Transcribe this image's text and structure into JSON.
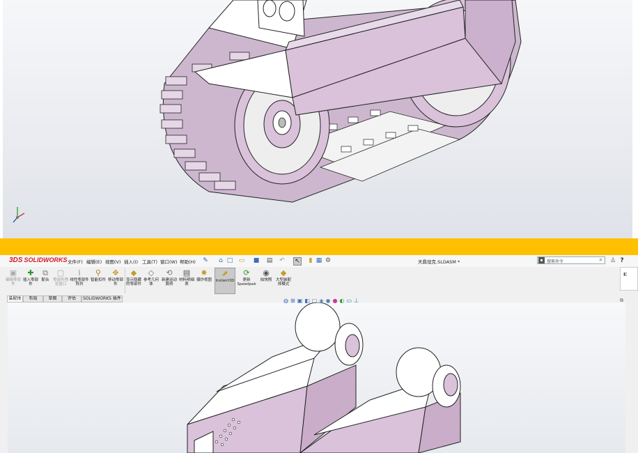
{
  "colors": {
    "divider": "#fec000",
    "part_fill": "#d9c2da",
    "part_face_light": "#ffffff",
    "brand_red": "#d31a24",
    "accent_blue": "#3a6fb8"
  },
  "top_viewport": {
    "model": "tracked-vehicle-assembly",
    "triad_icon": "triad-icon"
  },
  "menu": {
    "logo_prefix": "3DS",
    "logo_text": "SOLIDWORKS",
    "items": [
      "文件(F)",
      "编辑(E)",
      "视图(V)",
      "插入(I)",
      "工具(T)",
      "窗口(W)",
      "帮助(H)"
    ],
    "pin_icon": "pin-icon",
    "quick_access_icons": [
      "home-icon",
      "new-icon",
      "open-icon",
      "save-icon",
      "print-icon",
      "undo-icon",
      "select-icon",
      "rebuild-icon",
      "file-properties-icon",
      "options-icon"
    ],
    "document_title": "天鼎坦克.SLDASM *",
    "search_placeholder": "搜索命令",
    "user_icon": "user-icon",
    "help_label": "?"
  },
  "command_manager": {
    "buttons": [
      {
        "label": "编辑零部件",
        "enabled": false
      },
      {
        "label": "插入零部件",
        "enabled": true
      },
      {
        "label": "配合",
        "enabled": true
      },
      {
        "label": "零部件预览窗口",
        "enabled": false
      },
      {
        "label": "线性零部件阵列",
        "enabled": true
      },
      {
        "label": "智能扣件",
        "enabled": true
      },
      {
        "label": "移动零部件",
        "enabled": true
      },
      {
        "label": "显示隐藏的零部件",
        "enabled": true
      },
      {
        "label": "参考几何体",
        "enabled": true
      },
      {
        "label": "新建运动算例",
        "enabled": true
      },
      {
        "label": "材料明细表",
        "enabled": true
      },
      {
        "label": "爆炸视图",
        "enabled": true
      },
      {
        "label": "Instant3D",
        "enabled": true,
        "active": true
      },
      {
        "label": "更新Speedpak",
        "enabled": true
      },
      {
        "label": "拍快照",
        "enabled": true
      },
      {
        "label": "大型装配体模式",
        "enabled": true
      }
    ]
  },
  "tabs": [
    "装配体",
    "布局",
    "草图",
    "评估",
    "SOLIDWORKS 插件"
  ],
  "heads_up_icons": [
    "zoom-to-fit-icon",
    "zoom-area-icon",
    "previous-view-icon",
    "section-view-icon",
    "view-orientation-icon",
    "display-style-icon",
    "hide-show-icon",
    "appearance-icon",
    "scene-icon",
    "view-settings-icon",
    "ground-icon"
  ],
  "bottom_viewport": {
    "model": "track-link-parts"
  }
}
